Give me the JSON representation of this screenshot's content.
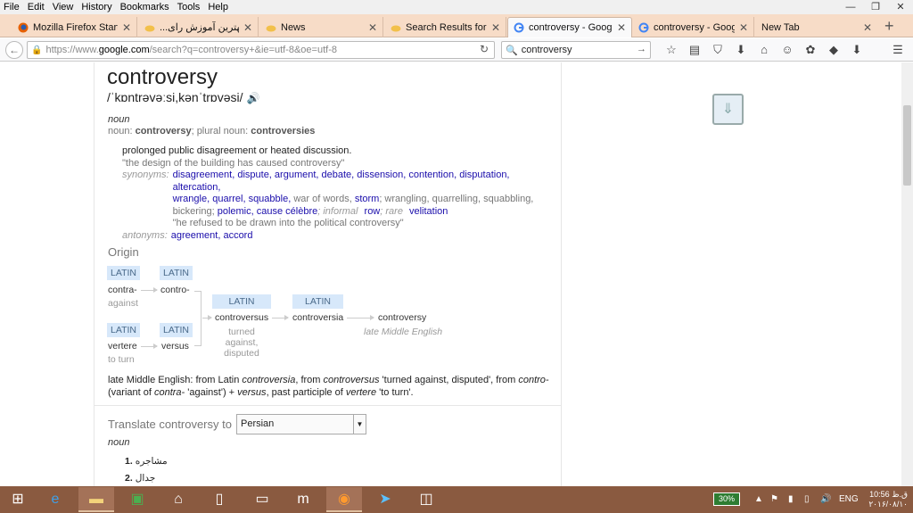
{
  "menu": [
    "File",
    "Edit",
    "View",
    "History",
    "Bookmarks",
    "Tools",
    "Help"
  ],
  "window_controls": [
    "—",
    "❐",
    "✕"
  ],
  "tabs": [
    {
      "title": "Mozilla Firefox Start P...",
      "close": "✕",
      "icon": "firefox-icon"
    },
    {
      "title": "...بهترین آموزش رای",
      "close": "✕",
      "icon": "page-icon"
    },
    {
      "title": "News",
      "close": "✕",
      "icon": "page-icon"
    },
    {
      "title": "Search Results for \"co...",
      "close": "✕",
      "icon": "page-icon"
    },
    {
      "title": "controversy - Google ...",
      "close": "✕",
      "icon": "google-icon"
    },
    {
      "title": "controversy - Google ...",
      "close": "✕",
      "icon": "google-icon"
    },
    {
      "title": "New Tab",
      "close": "✕",
      "icon": "blank"
    }
  ],
  "newtab_label": "+",
  "url": {
    "prefix": "https://www.",
    "domain": "google.com",
    "path": "/search?q=controversy+&ie=utf-8&oe=utf-8"
  },
  "search_value": "controversy",
  "dictionary": {
    "word": "controversy",
    "phonetic": "/ˈkɒntrəvəːsi,kənˈtrɒvəsi/",
    "pos": "noun",
    "forms_prefix": "noun: ",
    "form_sing": "controversy",
    "forms_mid": "; plural noun: ",
    "form_plural": "controversies",
    "definition": "prolonged public disagreement or heated discussion.",
    "example": "\"the design of the building has caused controversy\"",
    "synonyms_label": "synonyms:",
    "syn1": "disagreement, dispute, argument, debate, dissension, contention, disputation, altercation,",
    "syn2_a": "wrangle, quarrel, squabble,",
    "syn2_b": " war of words, ",
    "syn2_c": "storm",
    "syn2_d": "; wrangling, quarrelling, squabbling,",
    "syn3_a": "bickering; ",
    "syn3_b": "polemic, cause célèbre",
    "syn3_c": "; informal ",
    "syn3_d": "row",
    "syn3_e": "; rare ",
    "syn3_f": "velitation",
    "syn_example": "\"he refused to be drawn into the political controversy\"",
    "antonyms_label": "antonyms:",
    "antonyms": "agreement, accord"
  },
  "origin": {
    "heading": "Origin",
    "chip": "LATIN",
    "contra": "contra-",
    "contra_gloss": "against",
    "contro": "contro-",
    "vertere": "vertere",
    "vertere_gloss": "to turn",
    "versus": "versus",
    "controversus": "controversus",
    "controversus_gloss": "turned against, disputed",
    "controversia": "controversia",
    "controversy": "controversy",
    "controversy_gloss": "late Middle English"
  },
  "etymology": {
    "t1": "late Middle English: from Latin ",
    "i1": "controversia",
    "t2": ", from ",
    "i2": "controversus",
    "t3": " 'turned against, disputed', from ",
    "i3": "contro-",
    "t4": "(variant of ",
    "i4": "contra-",
    "t5": " 'against') + ",
    "i5": "versus",
    "t6": ", past participle of ",
    "i6": "vertere",
    "t7": " 'to turn'."
  },
  "translate": {
    "label": "Translate controversy to",
    "language": "Persian",
    "pos": "noun",
    "items": [
      {
        "num": "1.",
        "text": "مشاجره"
      },
      {
        "num": "2.",
        "text": "جدال"
      }
    ]
  },
  "taskbar": {
    "battery": "30%",
    "lang": "ENG",
    "time": "10:56 ق.ظ",
    "date": "۲۰۱۶/۰۸/۱۰"
  }
}
